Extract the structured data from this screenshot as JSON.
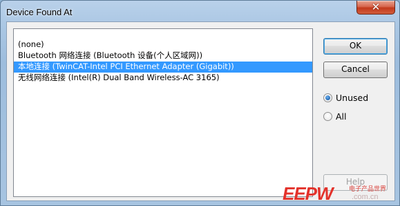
{
  "window": {
    "title": "Device Found At"
  },
  "titlebar": {
    "close_icon": "close-icon"
  },
  "list": {
    "items": [
      {
        "label": "(none)",
        "selected": false
      },
      {
        "label": "Bluetooth 网络连接 (Bluetooth 设备(个人区域网))",
        "selected": false
      },
      {
        "label": "本地连接 (TwinCAT-Intel PCI Ethernet Adapter (Gigabit))",
        "selected": true
      },
      {
        "label": "无线网络连接 (Intel(R) Dual Band Wireless-AC 3165)",
        "selected": false
      }
    ]
  },
  "buttons": {
    "ok": "OK",
    "cancel": "Cancel",
    "help": "Help"
  },
  "options": {
    "unused": "Unused",
    "all": "All",
    "selected": "unused"
  },
  "watermark": {
    "logo": "EEPW",
    "cn": "电子产品世界",
    "url": ".com.cn"
  },
  "colors": {
    "selection": "#3399ff",
    "close": "#c2391c"
  }
}
